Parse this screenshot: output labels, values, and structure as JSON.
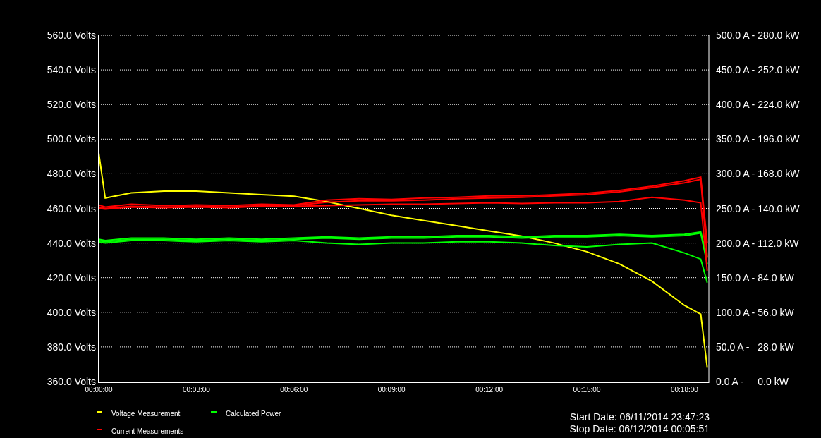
{
  "chart": {
    "chart_data": {
      "type": "line",
      "x": [
        0,
        0.2,
        1,
        2,
        3,
        4,
        5,
        6,
        7,
        8,
        9,
        10,
        11,
        12,
        13,
        14,
        15,
        16,
        17,
        18,
        18.5,
        18.7
      ],
      "xlim": [
        0,
        18.75
      ],
      "xticks": [
        {
          "value": 0,
          "label": "00:00:00"
        },
        {
          "value": 3,
          "label": "00:03:00"
        },
        {
          "value": 6,
          "label": "00:06:00"
        },
        {
          "value": 9,
          "label": "00:09:00"
        },
        {
          "value": 12,
          "label": "00:12:00"
        },
        {
          "value": 15,
          "label": "00:15:00"
        },
        {
          "value": 18,
          "label": "00:18:00"
        }
      ],
      "ylim": [
        360,
        560
      ],
      "yticks": [
        {
          "value": 360,
          "label": "360.0 Volts"
        },
        {
          "value": 380,
          "label": "380.0 Volts"
        },
        {
          "value": 400,
          "label": "400.0 Volts"
        },
        {
          "value": 420,
          "label": "420.0 Volts"
        },
        {
          "value": 440,
          "label": "440.0 Volts"
        },
        {
          "value": 460,
          "label": "460.0 Volts"
        },
        {
          "value": 480,
          "label": "480.0 Volts"
        },
        {
          "value": 500,
          "label": "500.0 Volts"
        },
        {
          "value": 520,
          "label": "520.0 Volts"
        },
        {
          "value": 540,
          "label": "540.0 Volts"
        },
        {
          "value": 560,
          "label": "560.0 Volts"
        }
      ],
      "y2lim": [
        0,
        500
      ],
      "y2ticks": [
        {
          "value": 0,
          "label": "0.0 A -"
        },
        {
          "value": 50,
          "label": "50.0 A -"
        },
        {
          "value": 100,
          "label": "100.0 A -"
        },
        {
          "value": 150,
          "label": "150.0 A -"
        },
        {
          "value": 200,
          "label": "200.0 A -"
        },
        {
          "value": 250,
          "label": "250.0 A -"
        },
        {
          "value": 300,
          "label": "300.0 A -"
        },
        {
          "value": 350,
          "label": "350.0 A -"
        },
        {
          "value": 400,
          "label": "400.0 A -"
        },
        {
          "value": 450,
          "label": "450.0 A -"
        },
        {
          "value": 500,
          "label": "500.0 A -"
        }
      ],
      "grid": true,
      "legend": "bottom",
      "y3lim": [
        0,
        280
      ],
      "y3ticks": [
        {
          "value": 0,
          "label": "0.0 kW"
        },
        {
          "value": 28,
          "label": "28.0 kW"
        },
        {
          "value": 56,
          "label": "56.0 kW"
        },
        {
          "value": 84,
          "label": "84.0 kW"
        },
        {
          "value": 112,
          "label": "112.0 kW"
        },
        {
          "value": 140,
          "label": "140.0 kW"
        },
        {
          "value": 168,
          "label": "168.0 kW"
        },
        {
          "value": 196,
          "label": "196.0 kW"
        },
        {
          "value": 224,
          "label": "224.0 kW"
        },
        {
          "value": 252,
          "label": "252.0 kW"
        },
        {
          "value": 280,
          "label": "280.0 kW"
        }
      ],
      "series": [
        {
          "name": "Voltage Measurement",
          "color": "#ffff00",
          "values": [
            492,
            466,
            469,
            470,
            470,
            469,
            468,
            467,
            464,
            460,
            456,
            453,
            450,
            447,
            444,
            440,
            435,
            428,
            418,
            404,
            399,
            368
          ]
        },
        {
          "name": "Calculated Power",
          "color": "#00ff00",
          "axis": "y3",
          "values": [
            115,
            114,
            116,
            116,
            115,
            116,
            115,
            116,
            117,
            116,
            117,
            117,
            118,
            118,
            117,
            118,
            118,
            119,
            118,
            119,
            121,
            100
          ]
        },
        {
          "color": "#00ff00",
          "axis": "y3",
          "values": [
            114,
            113,
            115,
            115,
            114,
            115,
            114,
            115,
            116,
            115,
            116,
            116,
            117,
            117,
            116,
            117,
            117,
            118,
            117,
            118,
            120,
            95
          ]
        },
        {
          "color": "#00ff00",
          "axis": "y3",
          "values": [
            113,
            112,
            114,
            114,
            113,
            114,
            113,
            114,
            112,
            111,
            112,
            112,
            113,
            113,
            112,
            110,
            109,
            111,
            112,
            104,
            99,
            80
          ]
        },
        {
          "name": "Current Measurements",
          "color": "#ff0000",
          "axis": "y2",
          "values": [
            255,
            252,
            256,
            254,
            255,
            254,
            256,
            255,
            262,
            264,
            263,
            265,
            266,
            268,
            268,
            270,
            272,
            276,
            282,
            290,
            295,
            200
          ]
        },
        {
          "color": "#ff0000",
          "axis": "y2",
          "values": [
            252,
            250,
            253,
            252,
            253,
            252,
            254,
            254,
            259,
            261,
            261,
            262,
            264,
            265,
            266,
            268,
            270,
            274,
            280,
            287,
            292,
            180
          ]
        },
        {
          "color": "#ff0000",
          "axis": "y2",
          "values": [
            250,
            249,
            252,
            251,
            252,
            251,
            253,
            253,
            254,
            255,
            256,
            256,
            257,
            258,
            257,
            258,
            258,
            260,
            266,
            262,
            258,
            160
          ]
        }
      ]
    }
  },
  "dates": [
    "Start Date: 06/11/2014 23:47:23",
    "Stop Date: 06/12/2014 00:05:51"
  ]
}
